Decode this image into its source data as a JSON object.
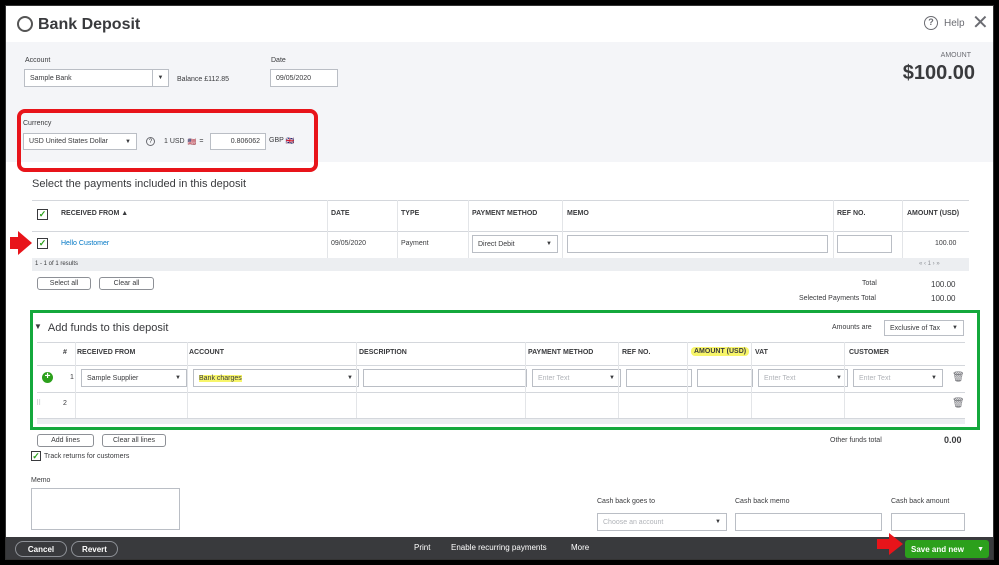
{
  "header": {
    "title": "Bank Deposit",
    "help_label": "Help",
    "amount_label": "AMOUNT",
    "amount_value": "$100.00"
  },
  "account": {
    "label": "Account",
    "value": "Sample Bank",
    "balance": "Balance £112.85"
  },
  "date": {
    "label": "Date",
    "value": "09/05/2020"
  },
  "currency": {
    "label": "Currency",
    "value": "USD United States Dollar",
    "rate_prefix": "1 USD",
    "rate_flag_from": "🇺🇸",
    "equals": "=",
    "rate_value": "0.806062",
    "rate_suffix": "GBP",
    "rate_flag_to": "🇬🇧"
  },
  "payments": {
    "title": "Select the payments included in this deposit",
    "columns": [
      "RECEIVED FROM ▲",
      "DATE",
      "TYPE",
      "PAYMENT METHOD",
      "MEMO",
      "REF NO.",
      "AMOUNT (USD)"
    ],
    "row": {
      "received_from": "Hello Customer",
      "date": "09/05/2020",
      "type": "Payment",
      "payment_method": "Direct Debit",
      "amount": "100.00"
    },
    "results": "1 - 1 of 1 results",
    "pager": "« ‹ 1 › »",
    "select_all": "Select all",
    "clear_all": "Clear all",
    "total_label": "Total",
    "total_value": "100.00",
    "selected_total_label": "Selected Payments Total",
    "selected_total_value": "100.00"
  },
  "funds": {
    "title": "Add funds to this deposit",
    "amounts_are_label": "Amounts are",
    "amounts_are_value": "Exclusive of Tax",
    "columns": [
      "#",
      "RECEIVED FROM",
      "ACCOUNT",
      "DESCRIPTION",
      "PAYMENT METHOD",
      "REF NO.",
      "AMOUNT (USD)",
      "VAT",
      "CUSTOMER"
    ],
    "row1": {
      "num": "1",
      "received_from": "Sample Supplier",
      "account": "Bank charges",
      "payment_method_placeholder": "Enter Text",
      "vat_placeholder": "Enter Text",
      "customer_placeholder": "Enter Text"
    },
    "row2": {
      "num": "2"
    },
    "add_lines": "Add lines",
    "clear_all_lines": "Clear all lines",
    "track_returns": "Track returns for customers",
    "other_funds_label": "Other funds total",
    "other_funds_value": "0.00"
  },
  "memo": {
    "label": "Memo"
  },
  "cashback": {
    "goes_to_label": "Cash back goes to",
    "goes_to_placeholder": "Choose an account",
    "memo_label": "Cash back memo",
    "amount_label": "Cash back amount"
  },
  "footer": {
    "cancel": "Cancel",
    "revert": "Revert",
    "print": "Print",
    "recurring": "Enable recurring payments",
    "more": "More",
    "save_new": "Save and new"
  },
  "colors": {
    "red_highlight": "#e8141a",
    "green_highlight": "#14a83c",
    "brand_green": "#2ca01c",
    "link_blue": "#0077c5",
    "yellow_highlight": "#f7f56a"
  }
}
